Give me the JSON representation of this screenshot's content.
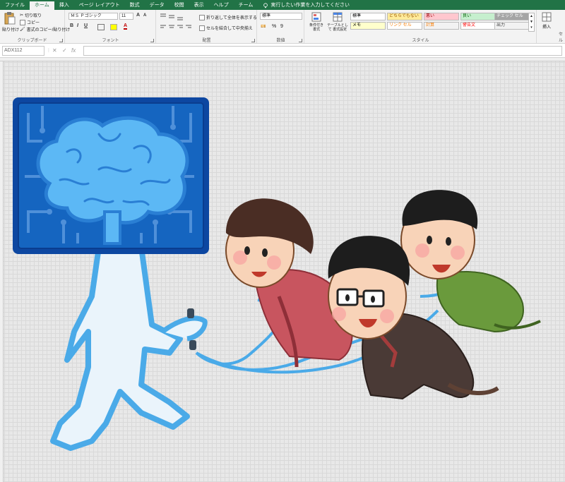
{
  "tabs": [
    "ファイル",
    "ホーム",
    "挿入",
    "ページ レイアウト",
    "数式",
    "データ",
    "校閲",
    "表示",
    "ヘルプ",
    "チーム"
  ],
  "active_tab": "ホーム",
  "tell_me": "実行したい作業を入力してください",
  "clipboard": {
    "paste": "貼り付け",
    "cut": "切り取り",
    "copy": "コピー",
    "format_painter": "書式のコピー/貼り付け",
    "label": "クリップボード"
  },
  "font": {
    "name": "ＭＳ Ｐゴシック",
    "size": "11",
    "bold": "B",
    "italic": "I",
    "underline": "U",
    "label": "フォント"
  },
  "alignment": {
    "wrap": "折り返して全体を表示する",
    "merge": "セルを結合して中央揃え",
    "label": "配置"
  },
  "number": {
    "format": "標準",
    "percent": "%",
    "comma": "9",
    "label": "数値"
  },
  "styles": {
    "conditional": "条件付き 書式",
    "table": "テーブルとして 書式設定",
    "cells": [
      {
        "text": "標準",
        "bg": "#ffffff",
        "fg": "#000000"
      },
      {
        "text": "どちらでもない",
        "bg": "#ffeb9c",
        "fg": "#9c5700"
      },
      {
        "text": "悪い",
        "bg": "#ffc7ce",
        "fg": "#9c0006"
      },
      {
        "text": "良い",
        "bg": "#c6efce",
        "fg": "#006100"
      },
      {
        "text": "チェック セル",
        "bg": "#a5a5a5",
        "fg": "#ffffff"
      },
      {
        "text": "メモ",
        "bg": "#ffffcc",
        "fg": "#000000"
      },
      {
        "text": "リンク セル",
        "bg": "#ffffff",
        "fg": "#fa7d00"
      },
      {
        "text": "計算",
        "bg": "#f2f2f2",
        "fg": "#fa7d00"
      },
      {
        "text": "警告文",
        "bg": "#ffffff",
        "fg": "#ff0000"
      },
      {
        "text": "出力",
        "bg": "#f2f2f2",
        "fg": "#3f3f3f"
      }
    ],
    "label": "スタイル"
  },
  "cells_group": {
    "insert": "挿入",
    "label": "セル"
  },
  "namebox": "ADX112",
  "formula_icons": {
    "cancel": "✕",
    "enter": "✓",
    "fx": "fx"
  },
  "colors": {
    "excel_green": "#217346",
    "brain_blue": "#1e88e5"
  }
}
